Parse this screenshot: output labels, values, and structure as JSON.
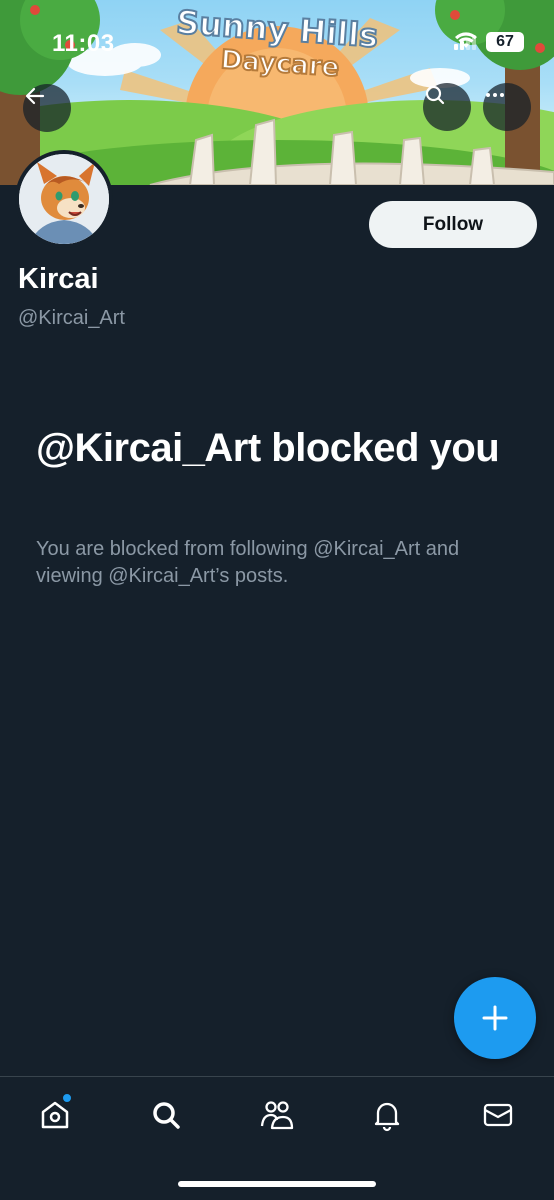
{
  "status_bar": {
    "time": "11:03",
    "battery": "67"
  },
  "banner": {
    "title_line1": "Sunny Hills",
    "title_line2": "Daycare"
  },
  "profile": {
    "display_name": "Kircai",
    "handle": "@Kircai_Art",
    "follow_label": "Follow"
  },
  "blocked": {
    "title": "@Kircai_Art blocked you",
    "description": "You are blocked from following @Kircai_Art and viewing @Kircai_Art’s posts."
  },
  "icons": {
    "back": "back-arrow-icon",
    "search": "search-icon",
    "more": "more-icon",
    "compose": "plus-icon",
    "nav": [
      "home-icon",
      "search-icon",
      "communities-icon",
      "bell-icon",
      "mail-icon"
    ]
  },
  "colors": {
    "background": "#15202b",
    "accent": "#1d9bf0",
    "secondary_text": "#8b98a5"
  }
}
